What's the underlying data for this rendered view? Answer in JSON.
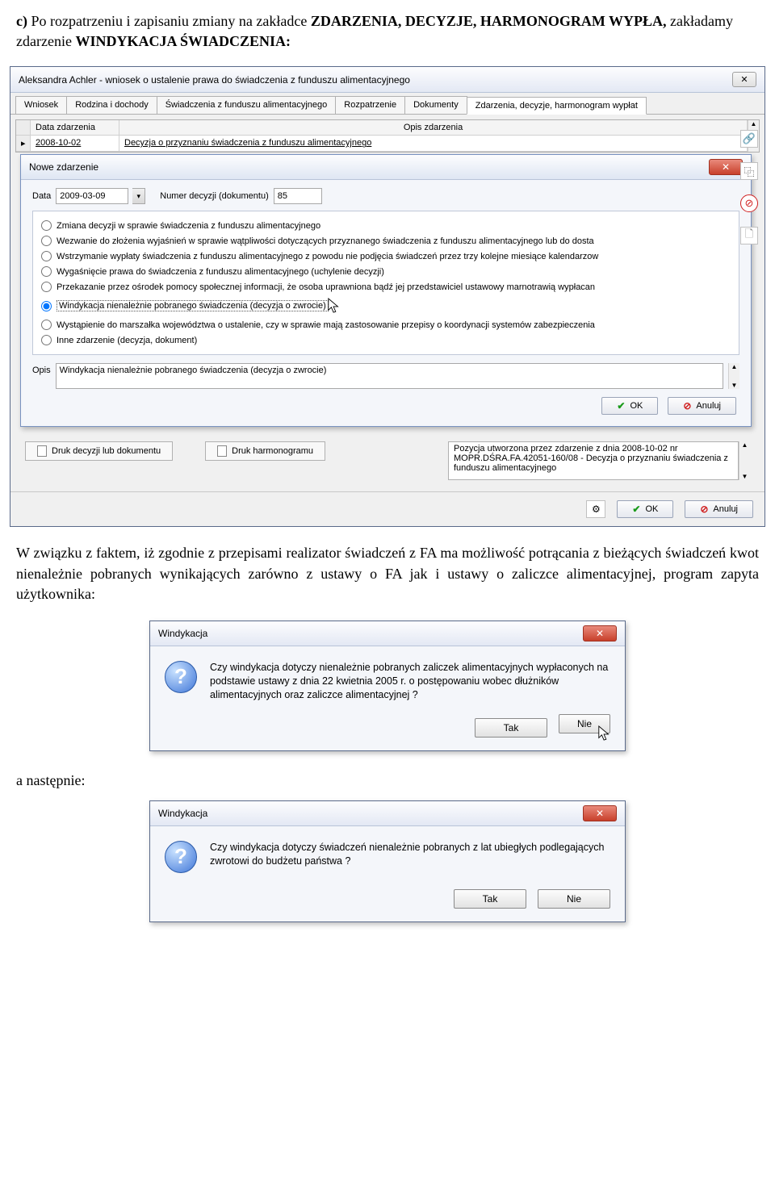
{
  "doc": {
    "intro_c": "c)",
    "intro_rest": " Po rozpatrzeniu i zapisaniu zmiany na zakładce ",
    "intro_bold1": "ZDARZENIA, DECYZJE, HARMONOGRAM WYPŁA,",
    "intro_rest2": " zakładamy zdarzenie ",
    "intro_bold2": "WINDYKACJA ŚWIADCZENIA:",
    "para2": "W związku z faktem, iż zgodnie z przepisami realizator świadczeń z FA ma możliwość potrącania z bieżących świadczeń kwot nienależnie pobranych wynikających zarówno z ustawy o FA jak i ustawy o zaliczce alimentacyjnej, program zapyta użytkownika:",
    "a_nastepnie": "a następnie:"
  },
  "mainWin": {
    "title": "Aleksandra Achler - wniosek o ustalenie prawa do świadczenia z funduszu alimentacyjnego",
    "tabs": [
      "Wniosek",
      "Rodzina i dochody",
      "Świadczenia z funduszu alimentacyjnego",
      "Rozpatrzenie",
      "Dokumenty",
      "Zdarzenia, decyzje, harmonogram wypłat"
    ],
    "grid": {
      "head_date": "Data zdarzenia",
      "head_desc": "Opis zdarzenia",
      "row_date": "2008-10-02",
      "row_desc": "Decyzja o przyznaniu świadczenia z funduszu alimentacyjnego"
    },
    "footer": {
      "btn_druk_decyzji": "Druk decyzji lub dokumentu",
      "btn_druk_harm": "Druk harmonogramu",
      "info": "Pozycja utworzona przez zdarzenie z dnia 2008-10-02 nr MOPR.DŚRA.FA.42051-160/08 - Decyzja o przyznaniu świadczenia z funduszu alimentacyjnego"
    },
    "ok": "OK",
    "anuluj": "Anuluj"
  },
  "subWin": {
    "title": "Nowe zdarzenie",
    "data_lbl": "Data",
    "data_val": "2009-03-09",
    "numer_lbl": "Numer decyzji (dokumentu)",
    "numer_val": "85",
    "radios": [
      "Zmiana decyzji w sprawie świadczenia z funduszu alimentacyjnego",
      "Wezwanie do złożenia wyjaśnień w sprawie wątpliwości dotyczących przyznanego świadczenia z funduszu alimentacyjnego lub do dosta",
      "Wstrzymanie wypłaty świadczenia z funduszu alimentacyjnego z powodu nie podjęcia świadczeń przez trzy kolejne miesiące kalendarzow",
      "Wygaśnięcie prawa do świadczenia z funduszu alimentacyjnego (uchylenie decyzji)",
      "Przekazanie przez ośrodek pomocy społecznej informacji, że osoba uprawniona bądź jej przedstawiciel ustawowy marnotrawią wypłacan",
      "Windykacja nienależnie pobranego świadczenia (decyzja o zwrocie)",
      "Wystąpienie do marszałka województwa o ustalenie, czy w sprawie mają zastosowanie przepisy o koordynacji systemów zabezpieczenia",
      "Inne zdarzenie (decyzja, dokument)"
    ],
    "selected": 5,
    "opis_lbl": "Opis",
    "opis_val": "Windykacja nienależnie pobranego świadczenia (decyzja o zwrocie)",
    "ok": "OK",
    "anuluj": "Anuluj"
  },
  "dialog1": {
    "title": "Windykacja",
    "text": "Czy windykacja dotyczy nienależnie pobranych zaliczek alimentacyjnych wypłaconych na podstawie ustawy z dnia 22 kwietnia 2005 r. o postępowaniu wobec dłużników alimentacyjnych oraz zaliczce alimentacyjnej ?",
    "tak": "Tak",
    "nie": "Nie"
  },
  "dialog2": {
    "title": "Windykacja",
    "text": "Czy windykacja dotyczy świadczeń nienależnie pobranych z lat ubiegłych podlegających zwrotowi do budżetu państwa ?",
    "tak": "Tak",
    "nie": "Nie"
  }
}
